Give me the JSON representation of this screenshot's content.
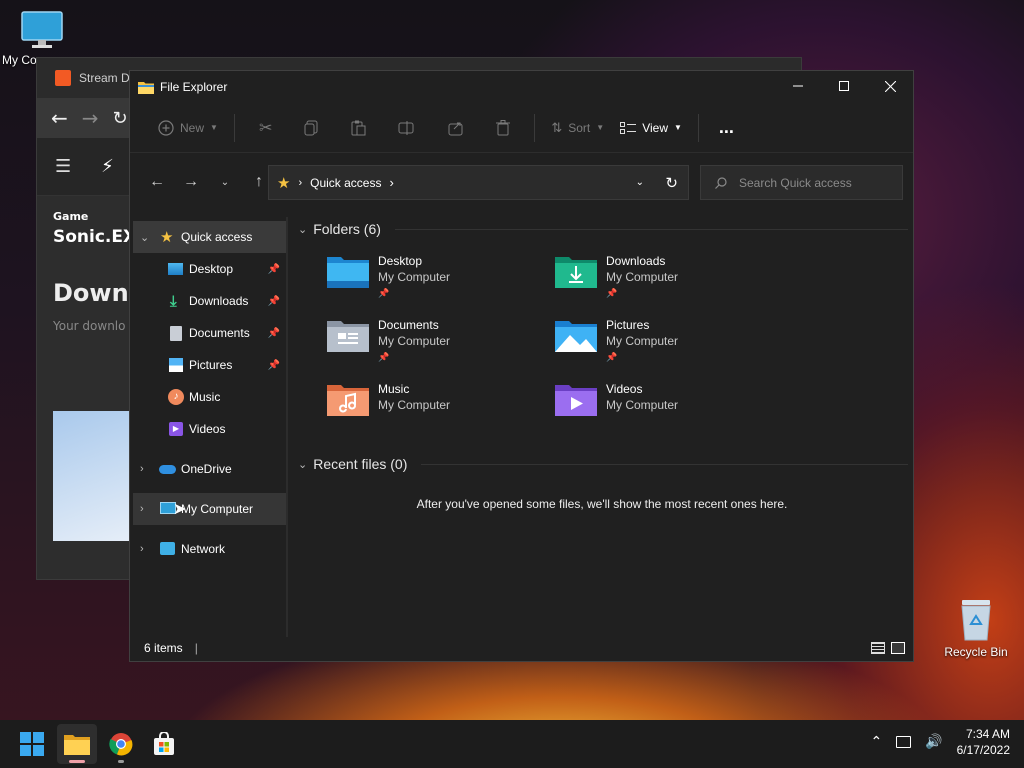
{
  "desktop": {
    "my_computer_label": "My Co",
    "recycle_bin_label": "Recycle Bin"
  },
  "background_window": {
    "title": "Stream D",
    "game_tag": "Game",
    "game_title": "Sonic.EXI",
    "heading": "Downl",
    "subtext": "Your downlo"
  },
  "explorer": {
    "title": "File Explorer",
    "toolbar": {
      "new_label": "New",
      "sort_label": "Sort",
      "view_label": "View",
      "more_label": "..."
    },
    "address": {
      "location": "Quick access"
    },
    "search": {
      "placeholder": "Search Quick access"
    },
    "nav": {
      "quick_access": "Quick access",
      "pinned": [
        {
          "label": "Desktop"
        },
        {
          "label": "Downloads"
        },
        {
          "label": "Documents"
        },
        {
          "label": "Pictures"
        },
        {
          "label": "Music"
        },
        {
          "label": "Videos"
        }
      ],
      "onedrive": "OneDrive",
      "my_computer": "My Computer",
      "network": "Network"
    },
    "folders_header": "Folders (6)",
    "folders": [
      {
        "name": "Desktop",
        "location": "My Computer",
        "pinned": true
      },
      {
        "name": "Downloads",
        "location": "My Computer",
        "pinned": true
      },
      {
        "name": "Documents",
        "location": "My Computer",
        "pinned": true
      },
      {
        "name": "Pictures",
        "location": "My Computer",
        "pinned": true
      },
      {
        "name": "Music",
        "location": "My Computer",
        "pinned": false
      },
      {
        "name": "Videos",
        "location": "My Computer",
        "pinned": false
      }
    ],
    "recent_header": "Recent files (0)",
    "recent_empty": "After you've opened some files, we'll show the most recent ones here.",
    "status": "6 items"
  },
  "taskbar": {
    "time": "7:34 AM",
    "date": "6/17/2022"
  },
  "colors": {
    "accent": "#0078d4",
    "folder_yellow": "#f5c242",
    "selection": "#3a3a3a"
  }
}
